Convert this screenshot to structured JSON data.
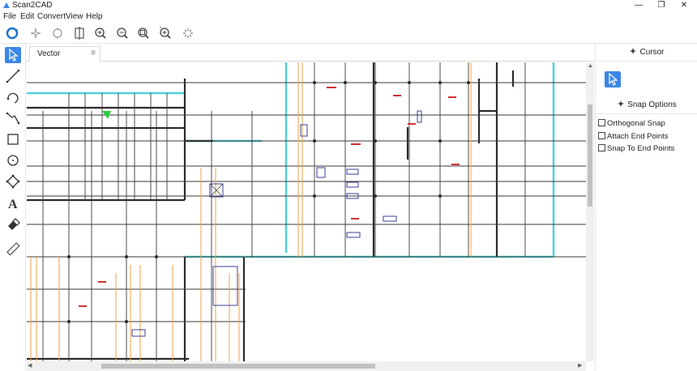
{
  "window": {
    "title": "Scan2CAD",
    "controls": {
      "minimize": "—",
      "maximize": "❐",
      "close": "✕"
    }
  },
  "menu": {
    "items": [
      "File",
      "Edit",
      "Convert",
      "View",
      "Help"
    ]
  },
  "toolbar": {
    "icons": [
      "refresh-icon",
      "sparkle-icon",
      "circle-select-icon",
      "split-icon",
      "zoom-in-icon",
      "zoom-out-icon",
      "zoom-fit-icon",
      "zoom-all-icon",
      "spinner-icon"
    ]
  },
  "left_tools": {
    "icons": [
      "select-pointer-icon",
      "line-icon",
      "arc-icon",
      "polyline-icon",
      "rectangle-icon",
      "circle-icon",
      "node-edit-icon",
      "text-icon",
      "eraser-icon",
      "ruler-icon"
    ],
    "active": "select-pointer-icon"
  },
  "canvas": {
    "tab_label": "Vector",
    "tab_menu_glyph": "≡"
  },
  "right_panel": {
    "cursor_header": "Cursor",
    "snap_header": "Snap Options",
    "options": [
      {
        "label": "Orthogonal Snap",
        "checked": false
      },
      {
        "label": "Attach End Points",
        "checked": false
      },
      {
        "label": "Snap To End Points",
        "checked": false
      }
    ]
  },
  "colors": {
    "accent": "#3b86e8",
    "wall": "#2b2b2b",
    "cyan": "#4fd1d9",
    "orange": "#f0a040",
    "blue_box": "#3a3f9a",
    "red_text": "#d03030"
  }
}
